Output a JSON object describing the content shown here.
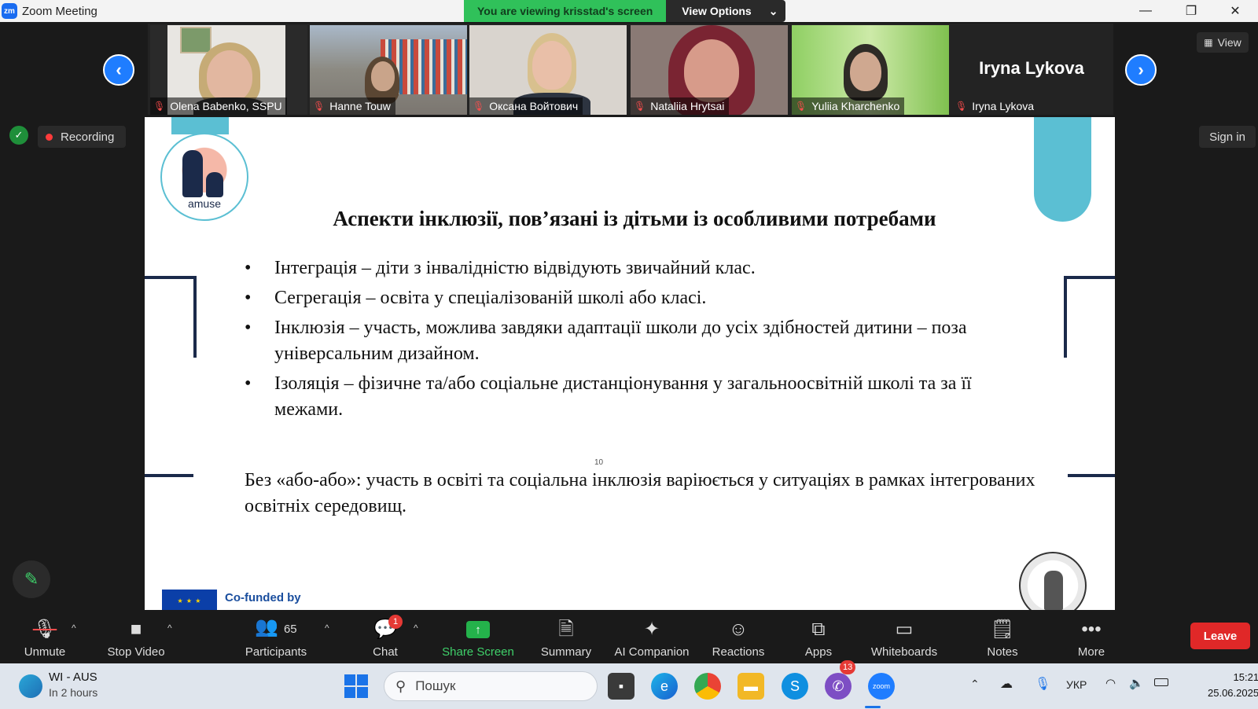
{
  "window": {
    "title": "Zoom Meeting",
    "logo_text": "zm",
    "viewing_banner": "You are viewing krisstad's screen",
    "view_options": "View Options",
    "view_options_caret": "⌄",
    "minimize": "—",
    "restore": "❐",
    "close": "✕"
  },
  "participants_strip": {
    "prev_glyph": "‹",
    "next_glyph": "›",
    "tiles": [
      {
        "name": "Olena Babenko, SSPU"
      },
      {
        "name": "Hanne Touw"
      },
      {
        "name": "Оксана Войтович"
      },
      {
        "name": "Nataliia Hrytsai"
      },
      {
        "name": "Yuliia Kharchenko"
      },
      {
        "name": "Iryna Lykova",
        "center_name": "Iryna Lykova"
      }
    ],
    "view_label": "View"
  },
  "status": {
    "recording": "Recording",
    "sign_in": "Sign in"
  },
  "slide": {
    "logo_text": "amuse",
    "title": "Аспекти інклюзії, пов’язані із дітьми із особливими потребами",
    "bullets": [
      "Інтеграція – діти з інвалідністю відвідують звичайний клас.",
      "Сегрегація – освіта у спеціалізованій школі або  класі.",
      "Інклюзія – участь, можлива завдяки адаптації школи до усіх здібностей дитини – поза універсальним дизайном.",
      "Ізоляція – фізичне та/або соціальне дистанціонування у загальноосвітній школі та за її межами."
    ],
    "page_number": "10",
    "footnote": "Без «або-або»: участь в освіті та соціальна інклюзія варіюється у ситуаціях в рамках інтегрованих освітніх середовищ.",
    "cofunded": "Co-funded by",
    "accent_color": "#5bbfd3",
    "bracket_color": "#1b2a4a"
  },
  "toolbar": {
    "unmute": "Unmute",
    "stop_video": "Stop Video",
    "participants": "Participants",
    "participants_count": "65",
    "chat": "Chat",
    "chat_badge": "1",
    "share_screen": "Share Screen",
    "summary": "Summary",
    "ai_companion": "AI Companion",
    "reactions": "Reactions",
    "apps": "Apps",
    "whiteboards": "Whiteboards",
    "notes": "Notes",
    "more": "More",
    "leave": "Leave"
  },
  "taskbar": {
    "weather_title": "WI - AUS",
    "weather_sub": "In 2 hours",
    "search_placeholder": "Пошук",
    "viber_badge": "13",
    "language": "УКР",
    "time": "15:21",
    "date": "25.06.2025"
  },
  "colors": {
    "zoom_blue": "#1f7dff",
    "share_green": "#24b24b",
    "leave_red": "#e02828",
    "banner_green": "#30c15a"
  }
}
